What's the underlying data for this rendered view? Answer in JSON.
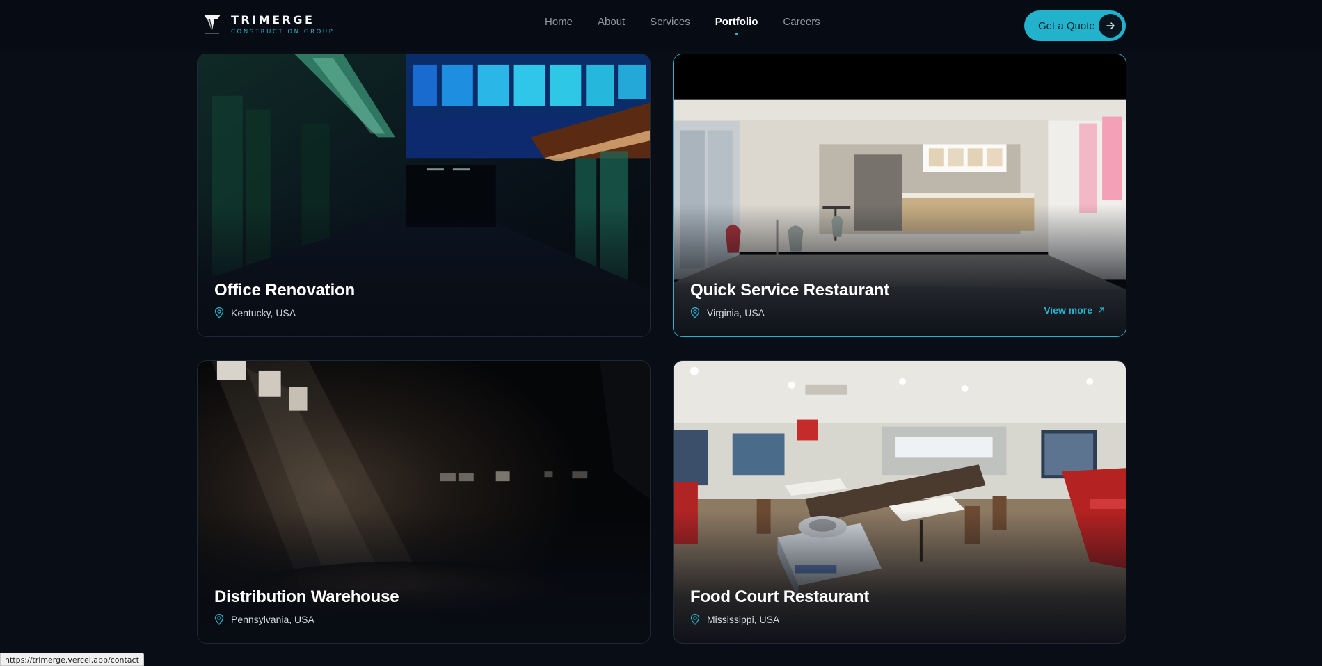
{
  "brand": {
    "name": "TRIMERGE",
    "tagline": "CONSTRUCTION GROUP",
    "accent": "#25b4cf"
  },
  "nav": {
    "items": [
      {
        "label": "Home",
        "active": false
      },
      {
        "label": "About",
        "active": false
      },
      {
        "label": "Services",
        "active": false
      },
      {
        "label": "Portfolio",
        "active": true
      },
      {
        "label": "Careers",
        "active": false
      }
    ]
  },
  "cta": {
    "label": "Get a Quote",
    "icon": "arrow-right-icon"
  },
  "projects": [
    {
      "title": "Office Renovation",
      "location": "Kentucky, USA",
      "icon": "location-pin-icon"
    },
    {
      "title": "Quick Service Restaurant",
      "location": "Virginia, USA",
      "icon": "location-pin-icon",
      "view_more": "View more",
      "hovered": true
    },
    {
      "title": "Distribution Warehouse",
      "location": "Pennsylvania, USA",
      "icon": "location-pin-icon"
    },
    {
      "title": "Food Court Restaurant",
      "location": "Mississippi, USA",
      "icon": "location-pin-icon"
    }
  ],
  "status_bar": {
    "url": "https://trimerge.vercel.app/contact"
  }
}
